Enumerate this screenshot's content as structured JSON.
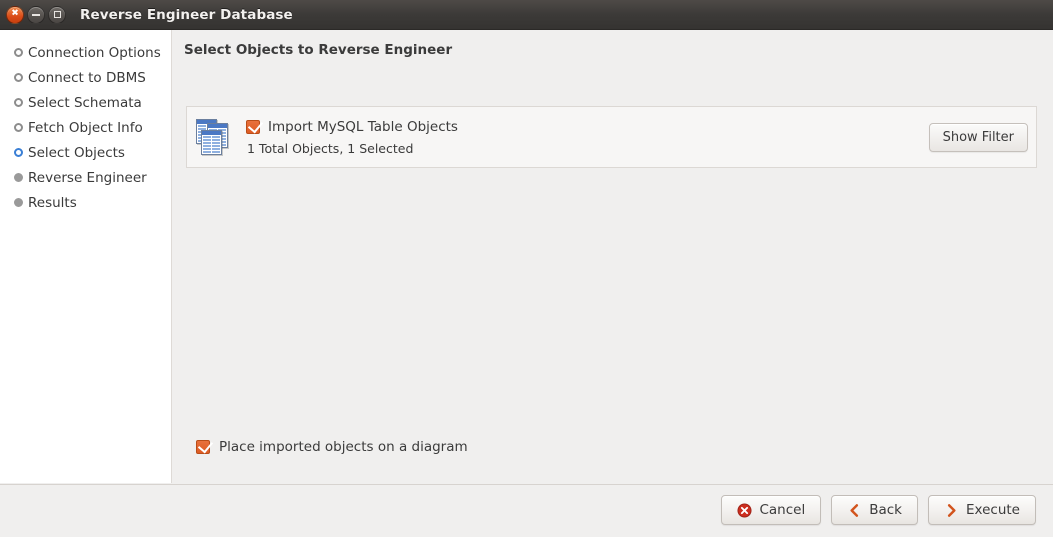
{
  "window": {
    "title": "Reverse Engineer Database",
    "controls": {
      "close": "close-button",
      "minimize": "minimize-button",
      "maximize": "maximize-button"
    }
  },
  "sidebar": {
    "items": [
      {
        "label": "Connection Options",
        "state": "done"
      },
      {
        "label": "Connect to DBMS",
        "state": "done"
      },
      {
        "label": "Select Schemata",
        "state": "done"
      },
      {
        "label": "Fetch Object Info",
        "state": "done"
      },
      {
        "label": "Select Objects",
        "state": "current"
      },
      {
        "label": "Reverse Engineer",
        "state": "todo"
      },
      {
        "label": "Results",
        "state": "todo"
      }
    ]
  },
  "main": {
    "page_title": "Select Objects to Reverse Engineer",
    "object_group": {
      "icon": "tables-icon",
      "checkbox_checked": true,
      "title": "Import MySQL Table Objects",
      "subtitle": "1 Total Objects, 1 Selected",
      "filter_button": "Show Filter"
    },
    "place_on_diagram": {
      "checked": true,
      "label": "Place imported objects on a diagram"
    }
  },
  "footer": {
    "cancel": "Cancel",
    "back": "Back",
    "execute": "Execute"
  },
  "colors": {
    "accent_orange": "#de5b22",
    "current_step_blue": "#3a7fd5",
    "titlebar": "#3c3a38",
    "cancel_red": "#cc2e1f"
  }
}
